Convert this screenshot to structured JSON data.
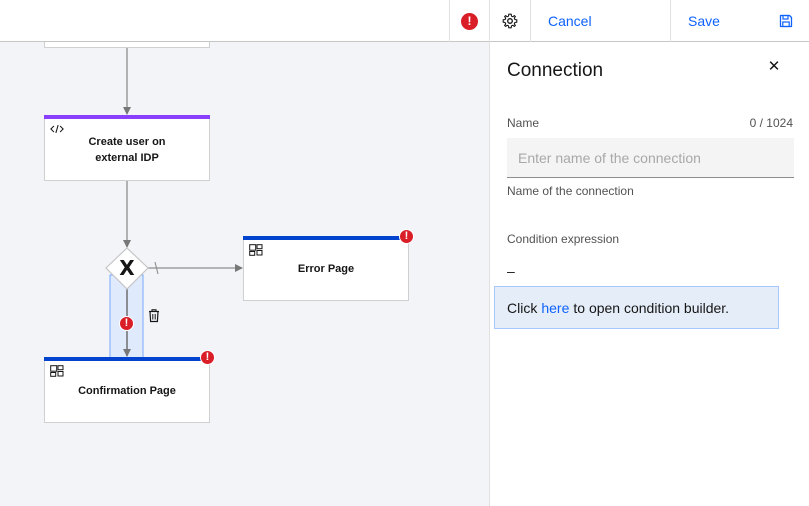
{
  "toolbar": {
    "error_glyph": "!",
    "cancel_label": "Cancel",
    "save_label": "Save"
  },
  "canvas": {
    "nodes": {
      "create_user": {
        "title_line1": "Create user on",
        "title_line2": "external IDP",
        "icon": "code-icon",
        "stripe_color": "#8a3ffc"
      },
      "error_page": {
        "title": "Error Page",
        "icon": "page-layout-icon",
        "stripe_color": "#0043ce",
        "error_glyph": "!"
      },
      "confirmation_page": {
        "title": "Confirmation Page",
        "icon": "page-layout-icon",
        "stripe_color": "#0043ce",
        "error_glyph": "!"
      }
    },
    "decision": {
      "label": "X",
      "icon": "decision-gateway-icon"
    },
    "connection_error_glyph": "!",
    "connection_actions": {
      "icon": "trash-icon"
    }
  },
  "panel": {
    "title": "Connection",
    "close_icon": "close-icon",
    "name_label": "Name",
    "name_counter": "0 / 1024",
    "name_value": "",
    "name_placeholder": "Enter name of the connection",
    "name_helper": "Name of the connection",
    "condition_label": "Condition expression",
    "condition_value": "–",
    "condition_prefix": "Click",
    "condition_link": "here",
    "condition_suffix": "to open condition builder."
  },
  "colors": {
    "accent": "#0f62fe",
    "error": "#da1e28",
    "canvas_bg": "#f2f4f8",
    "selection": "#d0e2ff"
  }
}
